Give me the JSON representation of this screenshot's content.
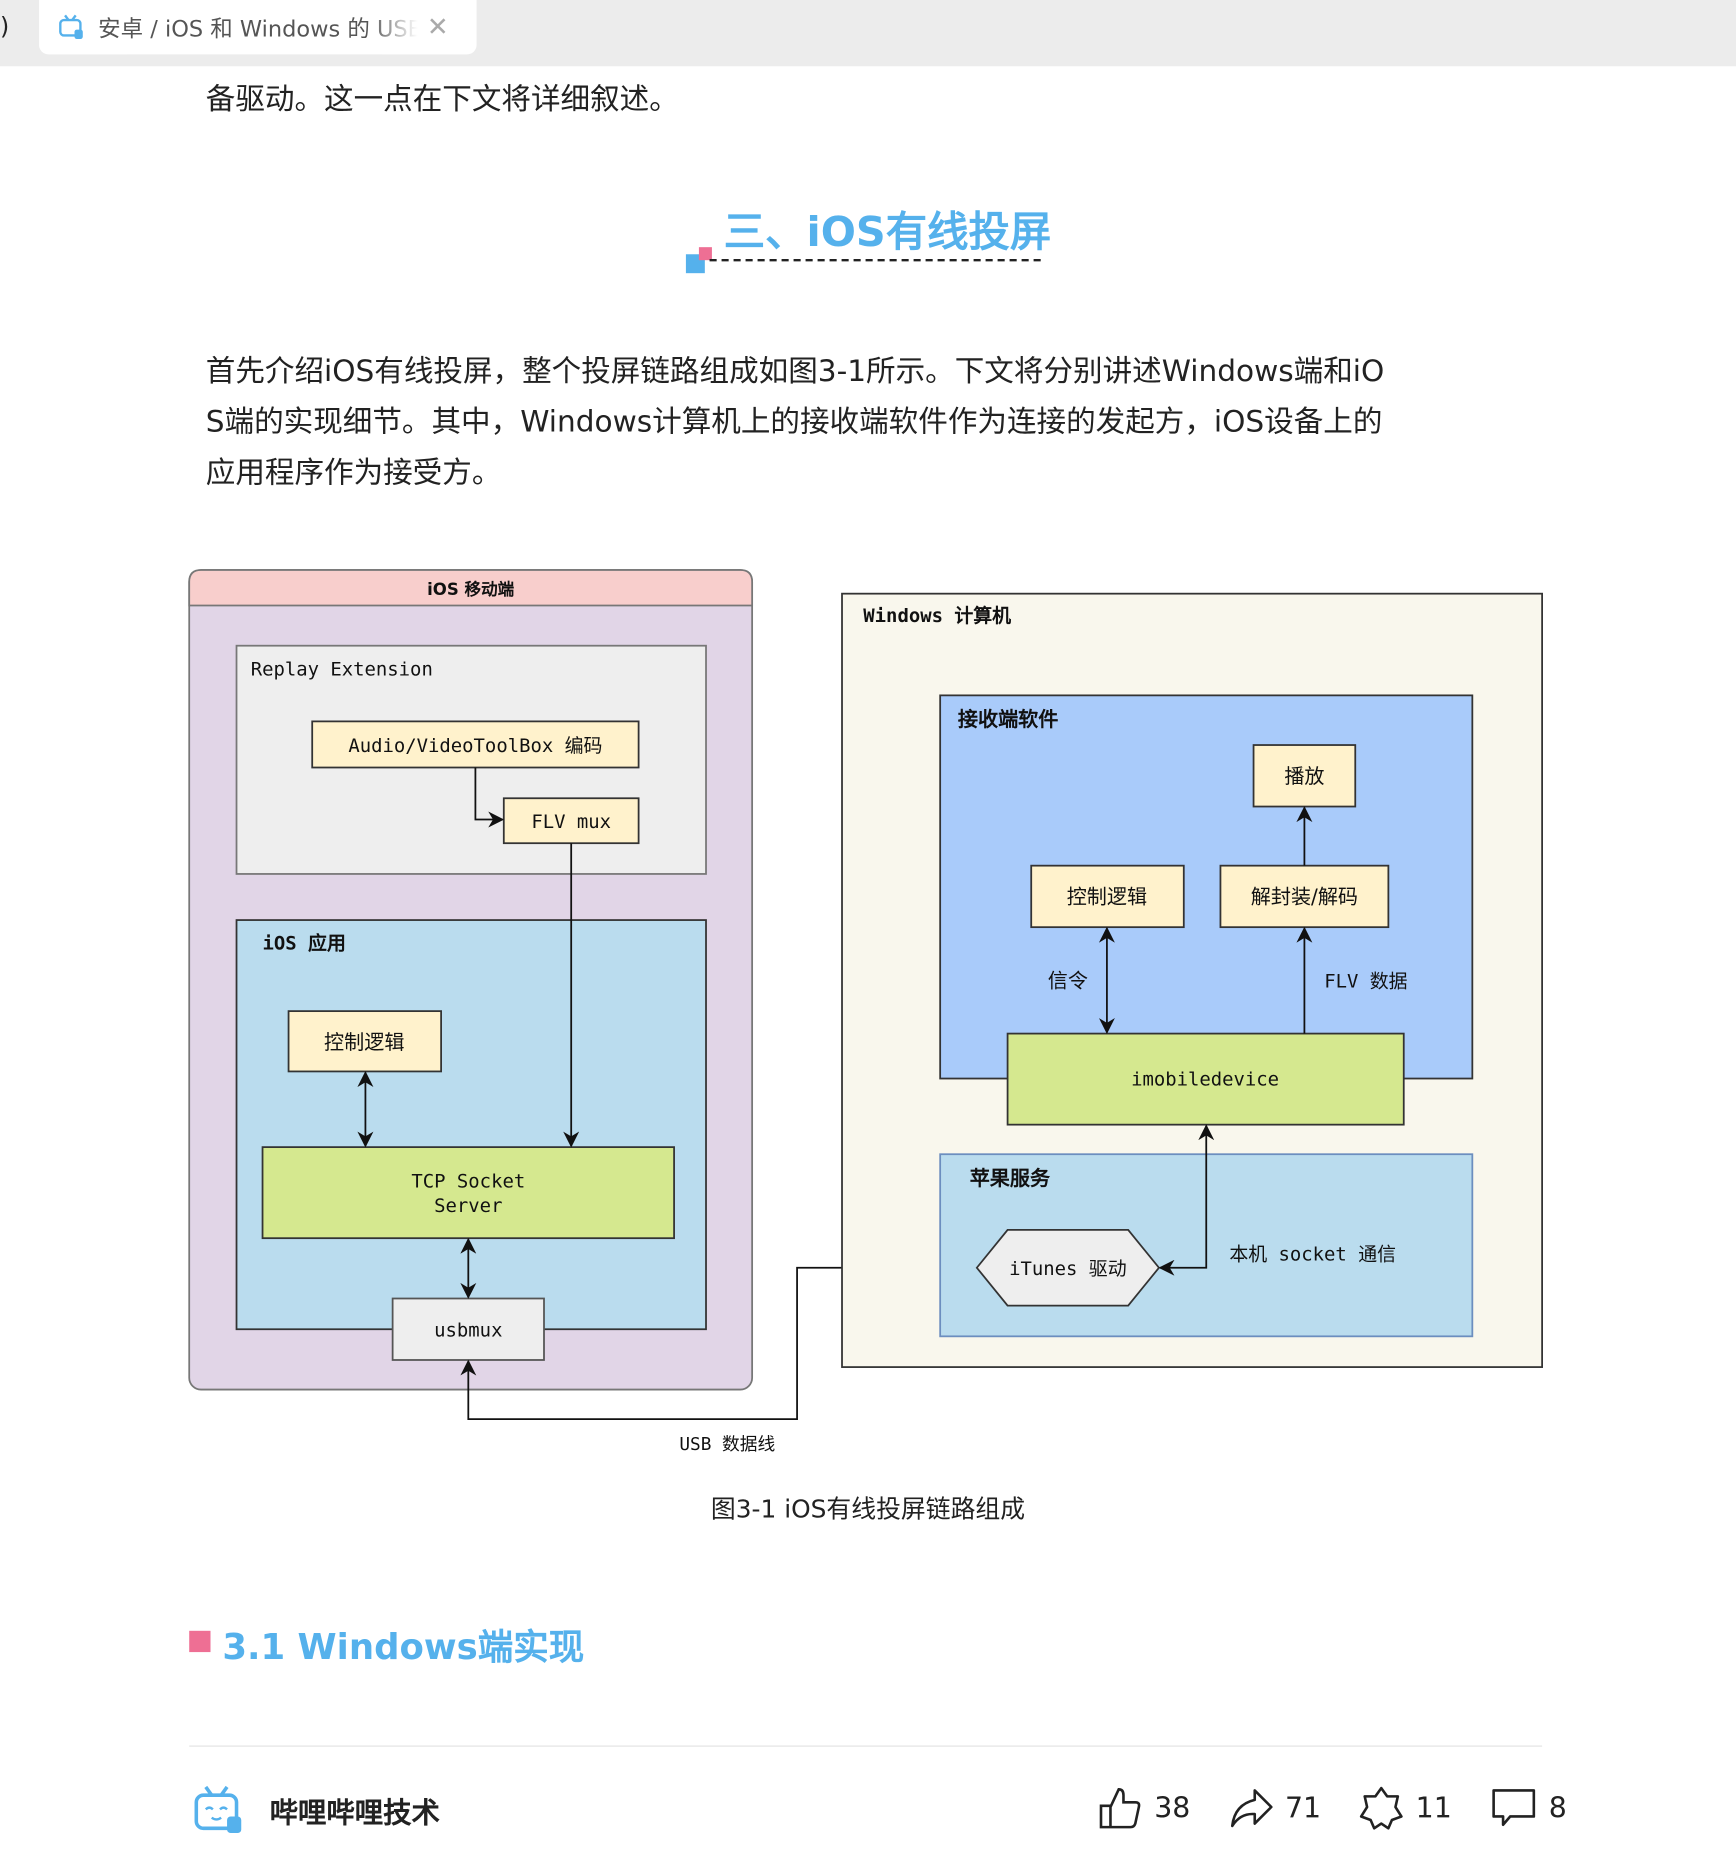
{
  "browser": {
    "tab_title": "安卓 / iOS 和 Windows 的 USB 投屏",
    "paren": ")"
  },
  "article": {
    "intro_line": "备驱动。这一点在下文将详细叙述。",
    "section_heading": "三、iOS有线投屏",
    "paragraph_lines": [
      "首先介绍iOS有线投屏，整个投屏链路组成如图3-1所示。下文将分别讲述Windows端和iO",
      "S端的实现细节。其中，Windows计算机上的接收端软件作为连接的发起方，iOS设备上的",
      "应用程序作为接受方。"
    ],
    "figure_caption": "图3-1   iOS有线投屏链路组成",
    "subheading": "3.1 Windows端实现"
  },
  "diagram": {
    "ios_title": "iOS 移动端",
    "replay_extension": "Replay Extension",
    "audio_video": "Audio/VideoToolBox 编码",
    "flv_mux": "FLV mux",
    "ios_app": "iOS 应用",
    "control_logic": "控制逻辑",
    "tcp_line1": "TCP Socket",
    "tcp_line2": "Server",
    "usbmux": "usbmux",
    "windows_title": "Windows 计算机",
    "receiver": "接收端软件",
    "play": "播放",
    "control_logic_win": "控制逻辑",
    "demux_decode": "解封装/解码",
    "signaling": "信令",
    "flv_data": "FLV 数据",
    "imobiledevice": "imobiledevice",
    "apple_services": "苹果服务",
    "itunes_driver": "iTunes 驱动",
    "local_socket": "本机 socket 通信",
    "usb_cable": "USB 数据线"
  },
  "footer": {
    "author": "哔哩哔哩技术",
    "likes": "38",
    "shares": "71",
    "favorites": "11",
    "comments": "8"
  },
  "colors": {
    "accent": "#55b1ec",
    "pink": "#ee6f94"
  }
}
